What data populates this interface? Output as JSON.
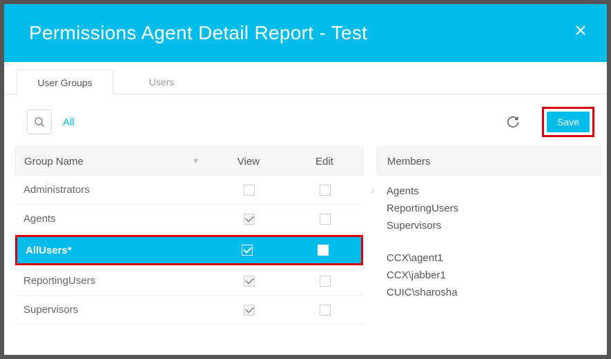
{
  "header": {
    "title": "Permissions Agent Detail Report - Test"
  },
  "tabs": [
    {
      "label": "User Groups",
      "active": true
    },
    {
      "label": "Users",
      "active": false
    }
  ],
  "toolbar": {
    "all_label": "All",
    "save_label": "Save"
  },
  "table": {
    "columns": {
      "group": "Group Name",
      "view": "View",
      "edit": "Edit"
    },
    "rows": [
      {
        "name": "Administrators",
        "view": "empty",
        "edit": "empty",
        "selected": false,
        "arrow": true
      },
      {
        "name": "Agents",
        "view": "checked-disabled",
        "edit": "empty",
        "selected": false
      },
      {
        "name": "AllUsers*",
        "view": "checked",
        "edit": "empty",
        "selected": true
      },
      {
        "name": "ReportingUsers",
        "view": "checked-disabled",
        "edit": "empty",
        "selected": false
      },
      {
        "name": "Supervisors",
        "view": "checked-disabled",
        "edit": "empty",
        "selected": false
      }
    ]
  },
  "members": {
    "header": "Members",
    "group1": [
      "Agents",
      "ReportingUsers",
      "Supervisors"
    ],
    "group2": [
      "CCX\\agent1",
      "CCX\\jabber1",
      "CUIC\\sharosha"
    ]
  }
}
